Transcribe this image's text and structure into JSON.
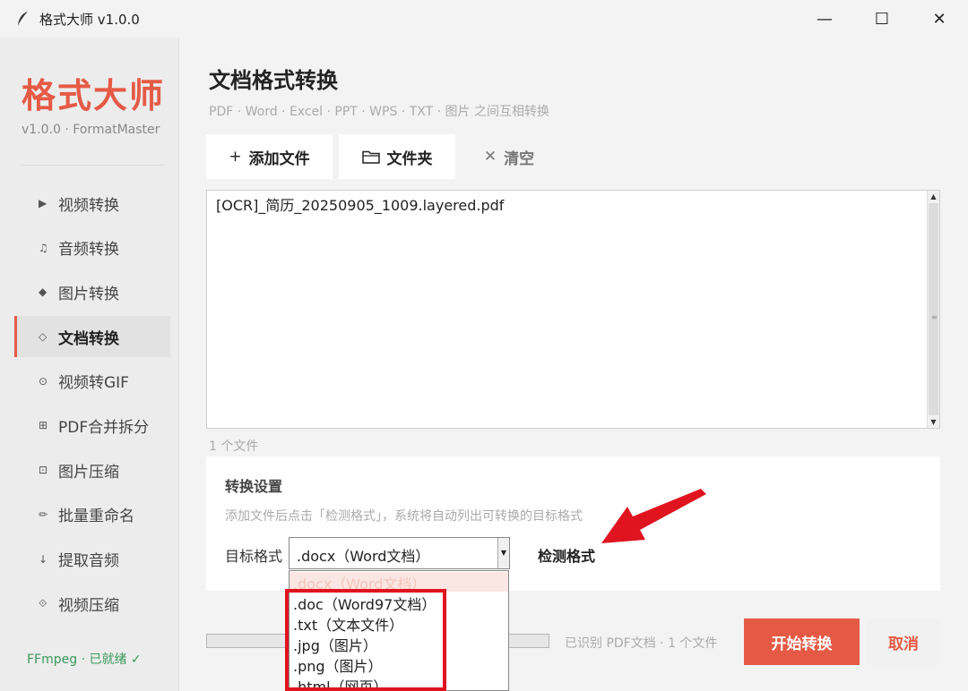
{
  "window": {
    "title": "格式大师 v1.0.0",
    "controls": {
      "minimize": "—",
      "maximize": "☐",
      "close": "✕"
    }
  },
  "sidebar": {
    "brand": "格式大师",
    "version": "v1.0.0 · FormatMaster",
    "items": [
      {
        "icon": "▶",
        "label": "视频转换"
      },
      {
        "icon": "♫",
        "label": "音频转换"
      },
      {
        "icon": "◆",
        "label": "图片转换"
      },
      {
        "icon": "◇",
        "label": "文档转换",
        "active": true
      },
      {
        "icon": "⊙",
        "label": "视频转GIF"
      },
      {
        "icon": "⊞",
        "label": "PDF合并拆分"
      },
      {
        "icon": "⊡",
        "label": "图片压缩"
      },
      {
        "icon": "✏",
        "label": "批量重命名"
      },
      {
        "icon": "↓",
        "label": "提取音频"
      },
      {
        "icon": "⟐",
        "label": "视频压缩"
      }
    ],
    "status": "FFmpeg · 已就绪 ✓"
  },
  "main": {
    "title": "文档格式转换",
    "subtitle": "PDF · Word · Excel · PPT · WPS · TXT · 图片 之间互相转换",
    "toolbar": {
      "add_icon": "+",
      "add_label": "添加文件",
      "folder_label": "文件夹",
      "clear_icon": "✕",
      "clear_label": "清空"
    },
    "files": [
      "[OCR]_简历_20250905_1009.layered.pdf"
    ],
    "file_count": "1 个文件",
    "settings": {
      "title": "转换设置",
      "hint": "添加文件后点击「检测格式」，系统将自动列出可转换的目标格式",
      "target_label": "目标格式",
      "selected": ".docx（Word文档）",
      "detect_label": "检测格式",
      "options": [
        ".docx（Word文档）",
        ".doc（Word97文档）",
        ".txt（文本文件）",
        ".jpg（图片）",
        ".png（图片）",
        ".html（网页）"
      ]
    },
    "progress": 0,
    "recognized": "已识别 PDF文档 · 1 个文件",
    "start_label": "开始转换",
    "cancel_label": "取消"
  },
  "colors": {
    "accent": "#e55a45",
    "annotation": "#e0141f",
    "ok": "#3a9a5b"
  }
}
